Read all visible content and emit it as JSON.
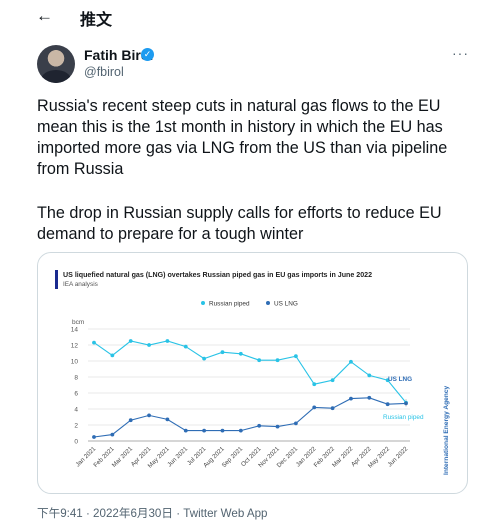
{
  "header": {
    "title": "推文"
  },
  "author": {
    "name": "Fatih Birol",
    "handle": "@fbirol"
  },
  "tweet": {
    "paragraph1": "Russia's recent steep cuts in natural gas flows to the EU mean this is the 1st month in history in which the EU has imported more gas via LNG from the US than via pipeline from Russia",
    "paragraph2": "The drop in Russian supply calls for efforts to reduce EU demand to prepare for a tough winter"
  },
  "chart_data": {
    "type": "line",
    "title": "US liquefied natural gas (LNG) overtakes Russian piped gas in EU gas imports in June 2022",
    "subtitle": "IEA analysis",
    "ylabel": "bcm",
    "ylim": [
      0,
      14
    ],
    "yticks": [
      0,
      2,
      4,
      6,
      8,
      10,
      12,
      14
    ],
    "categories": [
      "Jan 2021",
      "Feb 2021",
      "Mar 2021",
      "Apr 2021",
      "May 2021",
      "Jun 2021",
      "Jul 2021",
      "Aug 2021",
      "Sep 2021",
      "Oct 2021",
      "Nov 2021",
      "Dec 2021",
      "Jan 2022",
      "Feb 2022",
      "Mar 2022",
      "Apr 2022",
      "May 2022",
      "Jun 2022"
    ],
    "series": [
      {
        "name": "Russian piped",
        "color": "#29c3e6",
        "values": [
          12.3,
          10.7,
          12.5,
          12.0,
          12.5,
          11.8,
          10.3,
          11.1,
          10.9,
          10.1,
          10.1,
          10.6,
          7.1,
          7.6,
          9.9,
          8.2,
          7.6,
          4.8
        ]
      },
      {
        "name": "US LNG",
        "color": "#2f6db5",
        "values": [
          0.5,
          0.8,
          2.6,
          3.2,
          2.7,
          1.3,
          1.3,
          1.3,
          1.3,
          1.9,
          1.8,
          2.2,
          4.2,
          4.1,
          5.3,
          5.4,
          4.6,
          4.7
        ]
      }
    ],
    "annotations": [
      "US LNG",
      "Russian piped"
    ],
    "grid": true,
    "legend": "top",
    "watermark": "International Energy Agency"
  },
  "footer": {
    "meta": "下午9:41 · 2022年6月30日 · Twitter Web App"
  }
}
